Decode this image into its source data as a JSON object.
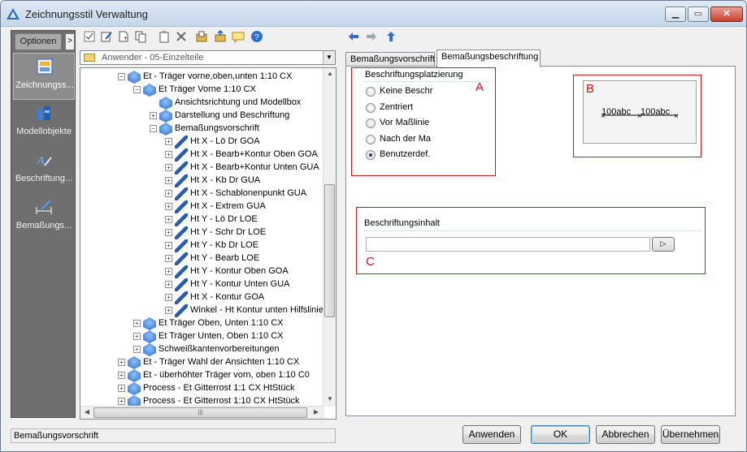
{
  "window": {
    "title": "Zeichnungsstil Verwaltung"
  },
  "left_panel": {
    "options_label": "Optionen",
    "options_arrow": ">",
    "items": [
      {
        "label": "Zeichnungss...",
        "icon": "drawing-style-icon"
      },
      {
        "label": "Modellobjekte",
        "icon": "model-objects-icon"
      },
      {
        "label": "Beschriftung...",
        "icon": "annotation-icon"
      },
      {
        "label": "Bemaßungs...",
        "icon": "dimension-icon"
      }
    ]
  },
  "toolbar": {
    "icons": [
      "checklist-icon",
      "edit-icon",
      "new-icon",
      "copy-icon",
      "paste-icon",
      "delete-icon",
      "import-icon",
      "export-icon",
      "comment-icon",
      "help-icon"
    ],
    "nav": [
      "back-arrow-icon",
      "forward-arrow-icon",
      "up-arrow-icon"
    ]
  },
  "combo": {
    "value": "Anwender - 05-Einzelteile"
  },
  "tree": {
    "rows": [
      {
        "text": "Et - Träger vorne,oben,unten 1:10 CX",
        "level": 0,
        "pm": "−"
      },
      {
        "text": "Et Träger Vorne 1:10 CX",
        "level": 1,
        "pm": "−"
      },
      {
        "text": "Ansichtsrichtung und Modellbox",
        "level": 2,
        "pm": ""
      },
      {
        "text": "Darstellung und Beschriftung",
        "level": 2,
        "pm": "+"
      },
      {
        "text": "Bemaßungsvorschrift",
        "level": 2,
        "pm": "−"
      },
      {
        "text": "Ht X - Lö Dr GOA",
        "level": 3,
        "pm": "+"
      },
      {
        "text": "Ht X - Bearb+Kontur Oben GOA",
        "level": 3,
        "pm": "+"
      },
      {
        "text": "Ht X - Bearb+Kontur Unten GUA",
        "level": 3,
        "pm": "+"
      },
      {
        "text": "Ht X - Kb Dr GUA",
        "level": 3,
        "pm": "+"
      },
      {
        "text": "Ht X - Schablonenpunkt GUA",
        "level": 3,
        "pm": "+"
      },
      {
        "text": "Ht X - Extrem GUA",
        "level": 3,
        "pm": "+"
      },
      {
        "text": "Ht Y - Lö Dr LOE",
        "level": 3,
        "pm": "+"
      },
      {
        "text": "Ht Y - Schr Dr LOE",
        "level": 3,
        "pm": "+"
      },
      {
        "text": "Ht Y - Kb Dr LOE",
        "level": 3,
        "pm": "+"
      },
      {
        "text": "Ht Y - Bearb LOE",
        "level": 3,
        "pm": "+"
      },
      {
        "text": "Ht Y - Kontur Oben GOA",
        "level": 3,
        "pm": "+"
      },
      {
        "text": "Ht Y - Kontur Unten GUA",
        "level": 3,
        "pm": "+"
      },
      {
        "text": "Ht X - Kontur GOA",
        "level": 3,
        "pm": "+"
      },
      {
        "text": "Winkel - Ht Kontur unten Hilfslinie",
        "level": 3,
        "pm": "+"
      },
      {
        "text": "Et Träger Oben, Unten 1:10 CX",
        "level": 1,
        "pm": "+"
      },
      {
        "text": "Et Träger Unten, Oben 1:10 CX",
        "level": 1,
        "pm": "+"
      },
      {
        "text": "Schweißkantenvorbereitungen",
        "level": 1,
        "pm": "+"
      },
      {
        "text": "Et - Träger Wahl der Ansichten 1:10 CX",
        "level": 0,
        "pm": "+"
      },
      {
        "text": "Et - überhöhter Träger vorn, oben 1:10 C0",
        "level": 0,
        "pm": "+"
      },
      {
        "text": "Process - Et Gitterrost 1:1 CX HtStück",
        "level": 0,
        "pm": "+"
      },
      {
        "text": "Process - Et Gitterrost 1:10 CX HtStück",
        "level": 0,
        "pm": "+"
      }
    ]
  },
  "status": {
    "text": "Bemaßungsvorschrift"
  },
  "tabs": [
    {
      "label": "Bemaßungsvorschrift",
      "active": false
    },
    {
      "label": "Bemaßungsbeschriftung",
      "active": true
    }
  ],
  "placement": {
    "title": "Beschriftungsplatzierung",
    "options": [
      {
        "label": "Keine Beschr",
        "selected": false
      },
      {
        "label": "Zentriert",
        "selected": false
      },
      {
        "label": "Vor Maßlinie",
        "selected": false
      },
      {
        "label": "Nach der Ma",
        "selected": false
      },
      {
        "label": "Benutzerdef.",
        "selected": true
      }
    ]
  },
  "preview": {
    "left_text": "100abc",
    "right_text": "100abc"
  },
  "content": {
    "title": "Beschriftungsinhalt",
    "value": "",
    "button": "▷"
  },
  "annotations": {
    "a": "A",
    "b": "B",
    "c": "C",
    "color": "#d4141a"
  },
  "buttons": {
    "apply": "Anwenden",
    "ok": "OK",
    "cancel": "Abbrechen",
    "take": "Übernehmen"
  }
}
